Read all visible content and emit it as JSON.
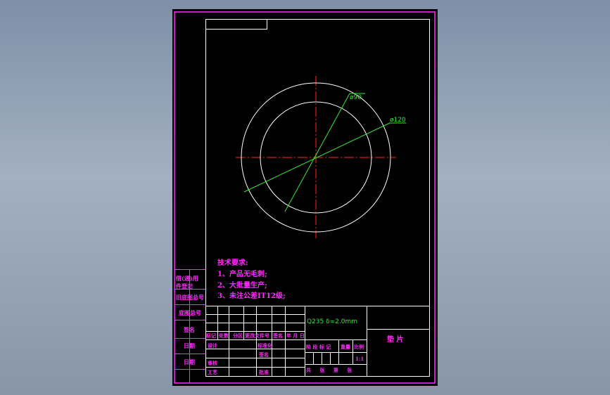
{
  "colors": {
    "background": "#7f8fa6",
    "sheet": "#000000",
    "frame": "#ff2bff",
    "inner_border": "#ffffff",
    "centerline": "#ff2a1a",
    "dimension": "#35e835",
    "text_magenta": "#ff2bff",
    "text_green": "#35e835"
  },
  "dimensions": {
    "inner_diameter": "ø90",
    "outer_diameter": "ø120"
  },
  "technical_requirements": {
    "title": "技术要求:",
    "items": [
      "1、产品无毛刺;",
      "2、大批量生产;",
      "3、未注公差IT12级;"
    ]
  },
  "left_strip": {
    "used_on_line1": "借(通)用",
    "used_on_line2": "件登记",
    "old_drawing_no": "旧底图总号",
    "base_drawing_no": "底图总号",
    "signature": "签名",
    "date1": "日期",
    "date2": "日期"
  },
  "title_block": {
    "material": "Q235 δ=2.0mm",
    "part_name": "垫 片",
    "revision_header": [
      "标记",
      "处数",
      "分区",
      "更改文件号",
      "签名",
      "年 月 日"
    ],
    "design": "设计",
    "standardization": "标准化",
    "review": "审核",
    "process": "工艺",
    "approve": "批准",
    "signature2": "签名",
    "stage_header": [
      "阶 段 标 记",
      "重量",
      "比例"
    ],
    "scale": "1:1",
    "sheet_count": "共 张 第 张"
  }
}
